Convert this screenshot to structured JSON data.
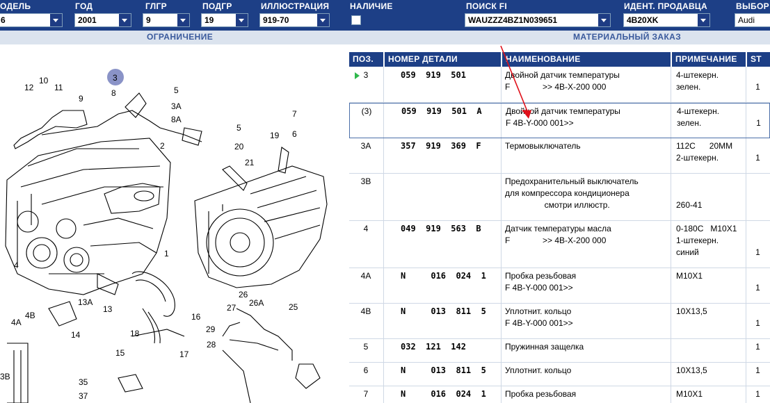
{
  "filters": {
    "model": {
      "label": "ОДЕЛЬ",
      "value": "6"
    },
    "year": {
      "label": "ГОД",
      "value": "2001"
    },
    "main_group": {
      "label": "ГЛГР",
      "value": "9"
    },
    "sub_group": {
      "label": "ПОДГР",
      "value": "19"
    },
    "illustration": {
      "label": "ИЛЛЮСТРАЦИЯ",
      "value": "919-70"
    },
    "stock": {
      "label": "НАЛИЧИЕ"
    },
    "vin_search": {
      "label": "ПОИСК FI",
      "value": "WAUZZZ4BZ1N039651"
    },
    "seller_id": {
      "label": "ИДЕНТ. ПРОДАВЦА",
      "value": "4B20XK"
    },
    "brand": {
      "label": "ВЫБОР",
      "value": "Audi"
    }
  },
  "sections": {
    "restriction": "ОГРАНИЧЕНИЕ",
    "material_order": "МАТЕРИАЛЬНЫЙ ЗАКАЗ"
  },
  "table": {
    "headers": {
      "pos": "ПОЗ.",
      "part_no": "НОМЕР ДЕТАЛИ",
      "name": "НАИМЕНОВАНИЕ",
      "note": "ПРИМЕЧАНИЕ",
      "st": "ST"
    },
    "rows": [
      {
        "pos": "3",
        "part_no": "059  919  501",
        "name": "Двойной датчик температуры\nF              >> 4B-X-200 000",
        "note": "4-штекерн.\nзелен.",
        "st": "1"
      },
      {
        "pos": "(3)",
        "part_no": "059  919  501  A",
        "name": "Двойной датчик температуры\nF 4B-Y-000 001>>",
        "note": "4-штекерн.\nзелен.",
        "st": "1"
      },
      {
        "pos": "3A",
        "part_no": "357  919  369  F",
        "name": "Термовыключатель",
        "note": "112C      20MM\n2-штекерн.",
        "st": "1"
      },
      {
        "pos": "3B",
        "part_no": "",
        "name": "Предохранительный выключатель\nдля компрессора кондиционера\n                 смотри иллюстр.",
        "note": "\n\n260-41",
        "st": ""
      },
      {
        "pos": "4",
        "part_no": "049  919  563  B",
        "name": "Датчик температуры масла\nF              >> 4B-X-200 000",
        "note": "0-180C   M10X1\n1-штекерн.\nсиний",
        "st": "1"
      },
      {
        "pos": "4A",
        "part_no": "N     016  024  1",
        "name": "Пробка резьбовая\nF 4B-Y-000 001>>",
        "note": "M10X1",
        "st": "1"
      },
      {
        "pos": "4B",
        "part_no": "N     013  811  5",
        "name": "Уплотнит. кольцо\nF 4B-Y-000 001>>",
        "note": "10X13,5",
        "st": "1"
      },
      {
        "pos": "5",
        "part_no": "032  121  142",
        "name": "Пружинная защелка",
        "note": "",
        "st": "1"
      },
      {
        "pos": "6",
        "part_no": "N     013  811  5",
        "name": "Уплотнит. кольцо",
        "note": "10X13,5",
        "st": "1"
      },
      {
        "pos": "7",
        "part_no": "N     016  024  1",
        "name": "Пробка резьбовая",
        "note": "M10X1",
        "st": "1"
      }
    ]
  },
  "illustration": {
    "callouts": [
      "3",
      "5",
      "10",
      "11",
      "12",
      "8",
      "9",
      "3A",
      "8A",
      "5",
      "7",
      "6",
      "19",
      "2",
      "20",
      "21",
      "1",
      "4",
      "13A",
      "13",
      "4A",
      "4B",
      "16",
      "18",
      "15",
      "14",
      "17",
      "27",
      "26",
      "26A",
      "25",
      "29",
      "28",
      "3B",
      "35",
      "37"
    ]
  },
  "colors": {
    "header_bg": "#1d3f86",
    "section_bg": "#dbe3ee",
    "arrow": "#e0101a",
    "selected_marker": "#2fb84c"
  }
}
